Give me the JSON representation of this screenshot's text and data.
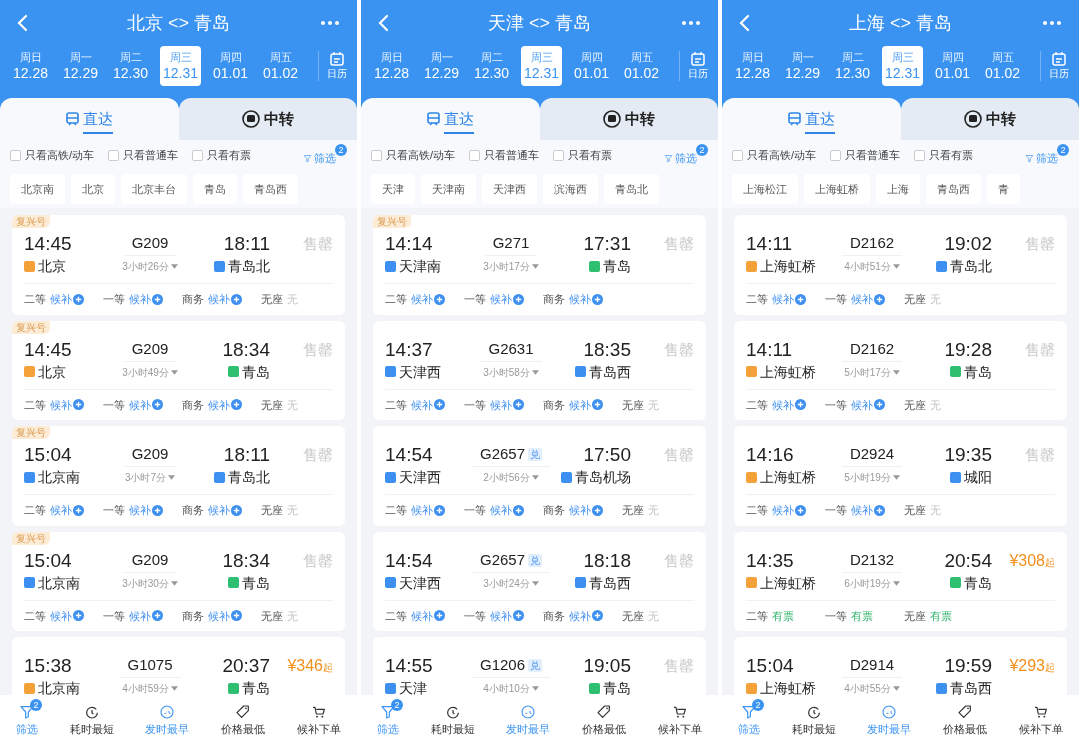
{
  "panels": [
    {
      "title": "北京 <> 青岛",
      "dates": [
        {
          "weekday": "周日",
          "date": "12.28",
          "selected": false
        },
        {
          "weekday": "周一",
          "date": "12.29",
          "selected": false
        },
        {
          "weekday": "周二",
          "date": "12.30",
          "selected": false
        },
        {
          "weekday": "周三",
          "date": "12.31",
          "selected": true
        },
        {
          "weekday": "周四",
          "date": "01.01",
          "selected": false
        },
        {
          "weekday": "周五",
          "date": "01.02",
          "selected": false
        }
      ],
      "calendar": "日历",
      "tabs": [
        {
          "label": "直达",
          "selected": true
        },
        {
          "label": "中转",
          "selected": false
        }
      ],
      "filters": [
        {
          "label": "只看高铁/动车",
          "checked": false
        },
        {
          "label": "只看普通车",
          "checked": false
        },
        {
          "label": "只看有票",
          "checked": false
        }
      ],
      "filter_button": {
        "label": "筛选",
        "badge": "2"
      },
      "stations": [
        "北京南",
        "北京",
        "北京丰台",
        "青岛",
        "青岛西"
      ],
      "trains": [
        {
          "badge": "复兴号",
          "depart": "14:45",
          "from": {
            "name": "北京",
            "kind": "start"
          },
          "number": "G209",
          "duration": "3小时26分",
          "arrive": "18:11",
          "to": {
            "name": "青岛北",
            "kind": "pass"
          },
          "status": {
            "kind": "soldout",
            "text": "售罄"
          },
          "seats": [
            {
              "class": "二等",
              "status": "候补",
              "kind": "waitlist"
            },
            {
              "class": "一等",
              "status": "候补",
              "kind": "waitlist"
            },
            {
              "class": "商务",
              "status": "候补",
              "kind": "waitlist"
            },
            {
              "class": "无座",
              "status": "无",
              "kind": "none"
            }
          ]
        },
        {
          "badge": "复兴号",
          "depart": "14:45",
          "from": {
            "name": "北京",
            "kind": "start"
          },
          "number": "G209",
          "duration": "3小时49分",
          "arrive": "18:34",
          "to": {
            "name": "青岛",
            "kind": "end"
          },
          "status": {
            "kind": "soldout",
            "text": "售罄"
          },
          "seats": [
            {
              "class": "二等",
              "status": "候补",
              "kind": "waitlist"
            },
            {
              "class": "一等",
              "status": "候补",
              "kind": "waitlist"
            },
            {
              "class": "商务",
              "status": "候补",
              "kind": "waitlist"
            },
            {
              "class": "无座",
              "status": "无",
              "kind": "none"
            }
          ]
        },
        {
          "badge": "复兴号",
          "depart": "15:04",
          "from": {
            "name": "北京南",
            "kind": "pass"
          },
          "number": "G209",
          "duration": "3小时7分",
          "arrive": "18:11",
          "to": {
            "name": "青岛北",
            "kind": "pass"
          },
          "status": {
            "kind": "soldout",
            "text": "售罄"
          },
          "seats": [
            {
              "class": "二等",
              "status": "候补",
              "kind": "waitlist"
            },
            {
              "class": "一等",
              "status": "候补",
              "kind": "waitlist"
            },
            {
              "class": "商务",
              "status": "候补",
              "kind": "waitlist"
            },
            {
              "class": "无座",
              "status": "无",
              "kind": "none"
            }
          ]
        },
        {
          "badge": "复兴号",
          "depart": "15:04",
          "from": {
            "name": "北京南",
            "kind": "pass"
          },
          "number": "G209",
          "duration": "3小时30分",
          "arrive": "18:34",
          "to": {
            "name": "青岛",
            "kind": "end"
          },
          "status": {
            "kind": "soldout",
            "text": "售罄"
          },
          "seats": [
            {
              "class": "二等",
              "status": "候补",
              "kind": "waitlist"
            },
            {
              "class": "一等",
              "status": "候补",
              "kind": "waitlist"
            },
            {
              "class": "商务",
              "status": "候补",
              "kind": "waitlist"
            },
            {
              "class": "无座",
              "status": "无",
              "kind": "none"
            }
          ]
        },
        {
          "depart": "15:38",
          "from": {
            "name": "北京南",
            "kind": "start"
          },
          "number": "G1075",
          "duration": "4小时59分",
          "arrive": "20:37",
          "to": {
            "name": "青岛",
            "kind": "end"
          },
          "status": {
            "kind": "price",
            "text": "¥346",
            "suffix": "起"
          }
        }
      ],
      "nav": [
        {
          "label": "筛选",
          "badge": "2",
          "selected": true
        },
        {
          "label": "耗时最短",
          "selected": false
        },
        {
          "label": "发时最早",
          "selected": true
        },
        {
          "label": "价格最低",
          "selected": false
        },
        {
          "label": "候补下单",
          "selected": false
        }
      ]
    },
    {
      "title": "天津 <> 青岛",
      "dates": [
        {
          "weekday": "周日",
          "date": "12.28",
          "selected": false
        },
        {
          "weekday": "周一",
          "date": "12.29",
          "selected": false
        },
        {
          "weekday": "周二",
          "date": "12.30",
          "selected": false
        },
        {
          "weekday": "周三",
          "date": "12.31",
          "selected": true
        },
        {
          "weekday": "周四",
          "date": "01.01",
          "selected": false
        },
        {
          "weekday": "周五",
          "date": "01.02",
          "selected": false
        }
      ],
      "calendar": "日历",
      "tabs": [
        {
          "label": "直达",
          "selected": true
        },
        {
          "label": "中转",
          "selected": false
        }
      ],
      "filters": [
        {
          "label": "只看高铁/动车",
          "checked": false
        },
        {
          "label": "只看普通车",
          "checked": false
        },
        {
          "label": "只看有票",
          "checked": false
        }
      ],
      "filter_button": {
        "label": "筛选",
        "badge": "2"
      },
      "stations": [
        "天津",
        "天津南",
        "天津西",
        "滨海西",
        "青岛北"
      ],
      "trains": [
        {
          "badge": "复兴号",
          "depart": "14:14",
          "from": {
            "name": "天津南",
            "kind": "pass"
          },
          "number": "G271",
          "duration": "3小时17分",
          "arrive": "17:31",
          "to": {
            "name": "青岛",
            "kind": "end"
          },
          "status": {
            "kind": "soldout",
            "text": "售罄"
          },
          "seats": [
            {
              "class": "二等",
              "status": "候补",
              "kind": "waitlist"
            },
            {
              "class": "一等",
              "status": "候补",
              "kind": "waitlist"
            },
            {
              "class": "商务",
              "status": "候补",
              "kind": "waitlist"
            }
          ]
        },
        {
          "depart": "14:37",
          "from": {
            "name": "天津西",
            "kind": "pass"
          },
          "number": "G2631",
          "duration": "3小时58分",
          "arrive": "18:35",
          "to": {
            "name": "青岛西",
            "kind": "pass"
          },
          "status": {
            "kind": "soldout",
            "text": "售罄"
          },
          "seats": [
            {
              "class": "二等",
              "status": "候补",
              "kind": "waitlist"
            },
            {
              "class": "一等",
              "status": "候补",
              "kind": "waitlist"
            },
            {
              "class": "商务",
              "status": "候补",
              "kind": "waitlist"
            },
            {
              "class": "无座",
              "status": "无",
              "kind": "none"
            }
          ]
        },
        {
          "depart": "14:54",
          "from": {
            "name": "天津西",
            "kind": "pass"
          },
          "number": "G2657",
          "tag": "兑",
          "duration": "2小时56分",
          "arrive": "17:50",
          "to": {
            "name": "青岛机场",
            "kind": "pass"
          },
          "status": {
            "kind": "soldout",
            "text": "售罄"
          },
          "seats": [
            {
              "class": "二等",
              "status": "候补",
              "kind": "waitlist"
            },
            {
              "class": "一等",
              "status": "候补",
              "kind": "waitlist"
            },
            {
              "class": "商务",
              "status": "候补",
              "kind": "waitlist"
            },
            {
              "class": "无座",
              "status": "无",
              "kind": "none"
            }
          ]
        },
        {
          "depart": "14:54",
          "from": {
            "name": "天津西",
            "kind": "pass"
          },
          "number": "G2657",
          "tag": "兑",
          "duration": "3小时24分",
          "arrive": "18:18",
          "to": {
            "name": "青岛西",
            "kind": "pass"
          },
          "status": {
            "kind": "soldout",
            "text": "售罄"
          },
          "seats": [
            {
              "class": "二等",
              "status": "候补",
              "kind": "waitlist"
            },
            {
              "class": "一等",
              "status": "候补",
              "kind": "waitlist"
            },
            {
              "class": "商务",
              "status": "候补",
              "kind": "waitlist"
            },
            {
              "class": "无座",
              "status": "无",
              "kind": "none"
            }
          ]
        },
        {
          "depart": "14:55",
          "from": {
            "name": "天津",
            "kind": "pass"
          },
          "number": "G1206",
          "tag": "兑",
          "duration": "4小时10分",
          "arrive": "19:05",
          "to": {
            "name": "青岛",
            "kind": "end"
          },
          "status": {
            "kind": "soldout",
            "text": "售罄"
          }
        }
      ],
      "nav": [
        {
          "label": "筛选",
          "badge": "2",
          "selected": true
        },
        {
          "label": "耗时最短",
          "selected": false
        },
        {
          "label": "发时最早",
          "selected": true
        },
        {
          "label": "价格最低",
          "selected": false
        },
        {
          "label": "候补下单",
          "selected": false
        }
      ]
    },
    {
      "title": "上海 <> 青岛",
      "dates": [
        {
          "weekday": "周日",
          "date": "12.28",
          "selected": false
        },
        {
          "weekday": "周一",
          "date": "12.29",
          "selected": false
        },
        {
          "weekday": "周二",
          "date": "12.30",
          "selected": false
        },
        {
          "weekday": "周三",
          "date": "12.31",
          "selected": true
        },
        {
          "weekday": "周四",
          "date": "01.01",
          "selected": false
        },
        {
          "weekday": "周五",
          "date": "01.02",
          "selected": false
        }
      ],
      "calendar": "日历",
      "tabs": [
        {
          "label": "直达",
          "selected": true
        },
        {
          "label": "中转",
          "selected": false
        }
      ],
      "filters": [
        {
          "label": "只看高铁/动车",
          "checked": false
        },
        {
          "label": "只看普通车",
          "checked": false
        },
        {
          "label": "只看有票",
          "checked": false
        }
      ],
      "filter_button": {
        "label": "筛选",
        "badge": "2"
      },
      "stations": [
        "上海松江",
        "上海虹桥",
        "上海",
        "青岛西",
        "青"
      ],
      "trains": [
        {
          "depart": "14:11",
          "from": {
            "name": "上海虹桥",
            "kind": "start"
          },
          "number": "D2162",
          "duration": "4小时51分",
          "arrive": "19:02",
          "to": {
            "name": "青岛北",
            "kind": "pass"
          },
          "status": {
            "kind": "soldout",
            "text": "售罄"
          },
          "seats": [
            {
              "class": "二等",
              "status": "候补",
              "kind": "waitlist"
            },
            {
              "class": "一等",
              "status": "候补",
              "kind": "waitlist"
            },
            {
              "class": "无座",
              "status": "无",
              "kind": "none"
            }
          ]
        },
        {
          "depart": "14:11",
          "from": {
            "name": "上海虹桥",
            "kind": "start"
          },
          "number": "D2162",
          "duration": "5小时17分",
          "arrive": "19:28",
          "to": {
            "name": "青岛",
            "kind": "end"
          },
          "status": {
            "kind": "soldout",
            "text": "售罄"
          },
          "seats": [
            {
              "class": "二等",
              "status": "候补",
              "kind": "waitlist"
            },
            {
              "class": "一等",
              "status": "候补",
              "kind": "waitlist"
            },
            {
              "class": "无座",
              "status": "无",
              "kind": "none"
            }
          ]
        },
        {
          "depart": "14:16",
          "from": {
            "name": "上海虹桥",
            "kind": "start"
          },
          "number": "D2924",
          "duration": "5小时19分",
          "arrive": "19:35",
          "to": {
            "name": "城阳",
            "kind": "pass"
          },
          "status": {
            "kind": "soldout",
            "text": "售罄"
          },
          "seats": [
            {
              "class": "二等",
              "status": "候补",
              "kind": "waitlist"
            },
            {
              "class": "一等",
              "status": "候补",
              "kind": "waitlist"
            },
            {
              "class": "无座",
              "status": "无",
              "kind": "none"
            }
          ]
        },
        {
          "depart": "14:35",
          "from": {
            "name": "上海虹桥",
            "kind": "start"
          },
          "number": "D2132",
          "duration": "6小时19分",
          "arrive": "20:54",
          "to": {
            "name": "青岛",
            "kind": "end"
          },
          "status": {
            "kind": "price",
            "text": "¥308",
            "suffix": "起"
          },
          "seats": [
            {
              "class": "二等",
              "status": "有票",
              "kind": "available"
            },
            {
              "class": "一等",
              "status": "有票",
              "kind": "available"
            },
            {
              "class": "无座",
              "status": "有票",
              "kind": "available"
            }
          ]
        },
        {
          "depart": "15:04",
          "from": {
            "name": "上海虹桥",
            "kind": "start"
          },
          "number": "D2914",
          "duration": "4小时55分",
          "arrive": "19:59",
          "to": {
            "name": "青岛西",
            "kind": "pass"
          },
          "status": {
            "kind": "price",
            "text": "¥293",
            "suffix": "起"
          }
        }
      ],
      "nav": [
        {
          "label": "筛选",
          "badge": "2",
          "selected": true
        },
        {
          "label": "耗时最短",
          "selected": false
        },
        {
          "label": "发时最早",
          "selected": true
        },
        {
          "label": "价格最低",
          "selected": false
        },
        {
          "label": "候补下单",
          "selected": false
        }
      ]
    }
  ]
}
